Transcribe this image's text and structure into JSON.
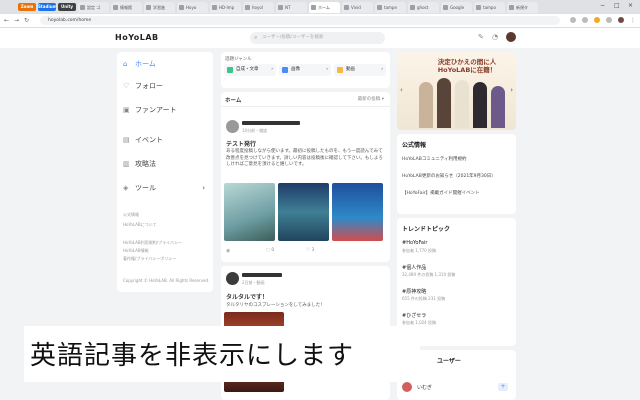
{
  "browser": {
    "tabs": [
      {
        "label": "Zoom",
        "color": "#e8710a",
        "pill": true
      },
      {
        "label": "Stadium",
        "color": "#1a73e8",
        "pill": true
      },
      {
        "label": "Unity",
        "color": "#3c4043",
        "pill": true
      },
      {
        "label": "設定 ゴ",
        "pill": false
      },
      {
        "label": "情報館",
        "pill": false
      },
      {
        "label": "学習進",
        "pill": false
      },
      {
        "label": "Hoyo",
        "pill": false
      },
      {
        "label": "HD-Imp",
        "pill": false
      },
      {
        "label": "hoyol",
        "pill": false
      },
      {
        "label": "NT",
        "pill": false
      },
      {
        "label": "ホーム",
        "pill": false,
        "active": true
      },
      {
        "label": "Vivid",
        "pill": false
      },
      {
        "label": "tampe",
        "pill": false
      },
      {
        "label": "ghost",
        "pill": false
      },
      {
        "label": "Google",
        "pill": false
      },
      {
        "label": "tampo",
        "pill": false
      },
      {
        "label": "新規タ",
        "pill": false
      }
    ],
    "url": "hoyolab.com/home"
  },
  "site": {
    "logo": "HoYoLAB",
    "search_placeholder": "ユーザー/投稿/ユーザーを検索"
  },
  "sidebar": {
    "items": [
      {
        "icon": "home-icon",
        "glyph": "⌂",
        "label": "ホーム",
        "active": true
      },
      {
        "icon": "follow-icon",
        "glyph": "♡",
        "label": "フォロー"
      },
      {
        "icon": "fanart-icon",
        "glyph": "▣",
        "label": "ファンアート"
      },
      {
        "icon": "event-icon",
        "glyph": "▤",
        "label": "イベント"
      },
      {
        "icon": "guide-icon",
        "glyph": "▥",
        "label": "攻略法"
      },
      {
        "icon": "tools-icon",
        "glyph": "◈",
        "label": "ツール"
      }
    ],
    "footer": [
      "公式情報",
      "HoYoLABについて",
      "HoYoLAB利用規約/プライバシー",
      "HoYoLAB情報",
      "著作権/プライバシーポリシー",
      "Copyright © HoYoLAB. All Rights Reserved."
    ]
  },
  "main": {
    "categories_title": "話題ジャンル",
    "categories": [
      {
        "label": "自成・文章",
        "color": "#3cc48b"
      },
      {
        "label": "画像",
        "color": "#4a8bf5"
      },
      {
        "label": "動画",
        "color": "#f5b942"
      }
    ],
    "feed_title": "ホーム",
    "feed_sort": "最新の投稿",
    "post1": {
      "author": "username_blurred",
      "time": "10分前・雑談",
      "title": "テスト発行",
      "body": "ある程度投稿しながら使います。最初に投稿したものを、もう一度読んでみて改善点を見つけていきます。詳しい内容は投稿後に確認して下さい。もしよろしければご意見を頂けると嬉しいです。",
      "likes": "3",
      "comments": "0"
    },
    "post2": {
      "author": "username",
      "time": "2日前・動画",
      "title": "タルタルです！",
      "body": "タルタリヤのコスプレーションをしてみました！"
    }
  },
  "right": {
    "banner_text": "決定ひかえの間に人HoYoLABに在籍！",
    "official_title": "公式情報",
    "official_items": [
      "HoYoLABコミュニティ利用規約",
      "HoYoLAB更新のお知らせ（2021年9月30日）",
      "【HoYoFair】掲載ガイド開催イベント"
    ],
    "trend_title": "トレンドトピック",
    "trends": [
      {
        "tag": "#HoYoFair",
        "meta": "参加者 1,770 投稿"
      },
      {
        "tag": "#個人作品",
        "meta": "32,489 件の投稿 1,310 投稿"
      },
      {
        "tag": "#原神攻略",
        "meta": "655 件の投稿 231 投稿"
      },
      {
        "tag": "#ひざセラ",
        "meta": "参加者 1,024 投稿"
      }
    ],
    "users_title": "ユーザー",
    "user_name": "いむぎ"
  },
  "overlay": {
    "subtitle": "英語記事を非表示にします"
  }
}
